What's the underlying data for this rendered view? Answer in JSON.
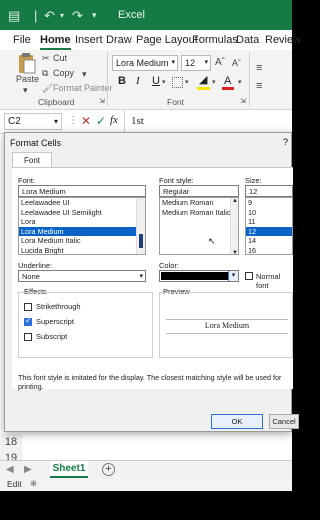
{
  "app": {
    "title": "Excel",
    "quick_access_icons": [
      "save-icon",
      "undo-icon",
      "redo-icon",
      "customize-icon"
    ]
  },
  "ribbon_tabs": [
    "File",
    "Home",
    "Insert",
    "Draw",
    "Page Layout",
    "Formulas",
    "Data",
    "Review"
  ],
  "active_tab": "Home",
  "clipboard": {
    "paste": "Paste",
    "cut": "Cut",
    "copy": "Copy",
    "format_painter": "Format Painter",
    "group_label": "Clipboard"
  },
  "font_group": {
    "font_name": "Lora Medium",
    "font_size": "12",
    "bold": "B",
    "italic": "I",
    "underline": "U",
    "font_color_glyph": "A",
    "group_label": "Font",
    "colors": {
      "highlight": "#f5e400",
      "font_color": "#e02020"
    }
  },
  "formula_bar": {
    "name_box": "C2",
    "fx": "fx",
    "value": "1st"
  },
  "dialog": {
    "title": "Format Cells",
    "help": "?",
    "tab": "Font",
    "font_label": "Font:",
    "font_value": "Lora Medium",
    "font_list": [
      "Leelawadee UI",
      "Leelawadee UI Semilight",
      "Lora",
      "Lora Medium",
      "Lora Medium Italic",
      "Lucida Bright"
    ],
    "font_selected_index": 3,
    "style_label": "Font style:",
    "style_value": "Regular",
    "style_list": [
      "Medium Roman",
      "Medium Roman Italic"
    ],
    "size_label": "Size:",
    "size_value": "12",
    "size_list": [
      "9",
      "10",
      "11",
      "12",
      "14",
      "16"
    ],
    "size_selected_index": 3,
    "underline_label": "Underline:",
    "underline_value": "None",
    "color_label": "Color:",
    "color_value": "#000000",
    "normal_font_label": "Normal font",
    "effects_label": "Effects",
    "effects": [
      {
        "label": "Strikethrough",
        "checked": false
      },
      {
        "label": "Superscript",
        "checked": true
      },
      {
        "label": "Subscript",
        "checked": false
      }
    ],
    "preview_label": "Preview",
    "preview_text": "Lora Medium",
    "note": "This font style is imitated for the display.  The closest matching style will be used for printing.",
    "ok": "OK",
    "cancel": "Cancel"
  },
  "rows": [
    "18",
    "19"
  ],
  "sheet_tab": "Sheet1",
  "add_sheet": "+",
  "status": "Edit",
  "accent": "#157a44"
}
